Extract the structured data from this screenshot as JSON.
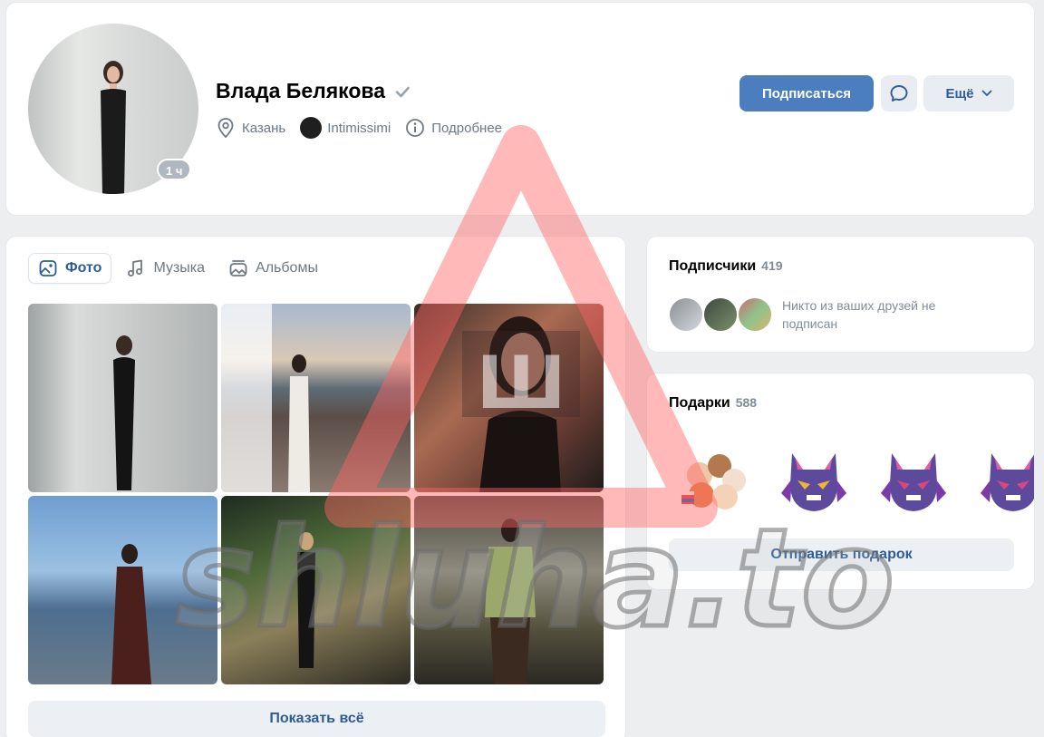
{
  "profile": {
    "name": "Влада Белякова",
    "online_badge": "1 ч",
    "city": "Казань",
    "company": "Intimissimi",
    "details_label": "Подробнее"
  },
  "actions": {
    "subscribe_label": "Подписаться",
    "more_label": "Ещё"
  },
  "photos": {
    "tabs": [
      {
        "label": "Фото",
        "active": true
      },
      {
        "label": "Музыка",
        "active": false
      },
      {
        "label": "Альбомы",
        "active": false
      }
    ],
    "show_all_label": "Показать всё"
  },
  "followers": {
    "title": "Подписчики",
    "count": "419",
    "note": "Никто из ваших друзей не подписан"
  },
  "gifts": {
    "title": "Подарки",
    "count": "588",
    "send_label": "Отправить подарок"
  },
  "watermark": {
    "text": "shluha.to",
    "letter": "Ш"
  },
  "colors": {
    "accent": "#4b7ebf",
    "link": "#2c5d96",
    "muted": "#818c99",
    "background": "#edeef0"
  },
  "icons": {
    "verified": "checkmark-icon",
    "city": "location-pin-icon",
    "details": "info-icon",
    "message": "message-bubble-icon",
    "more": "chevron-down-icon",
    "photo_tab": "photo-icon",
    "music_tab": "music-note-icon",
    "albums_tab": "albums-icon"
  }
}
